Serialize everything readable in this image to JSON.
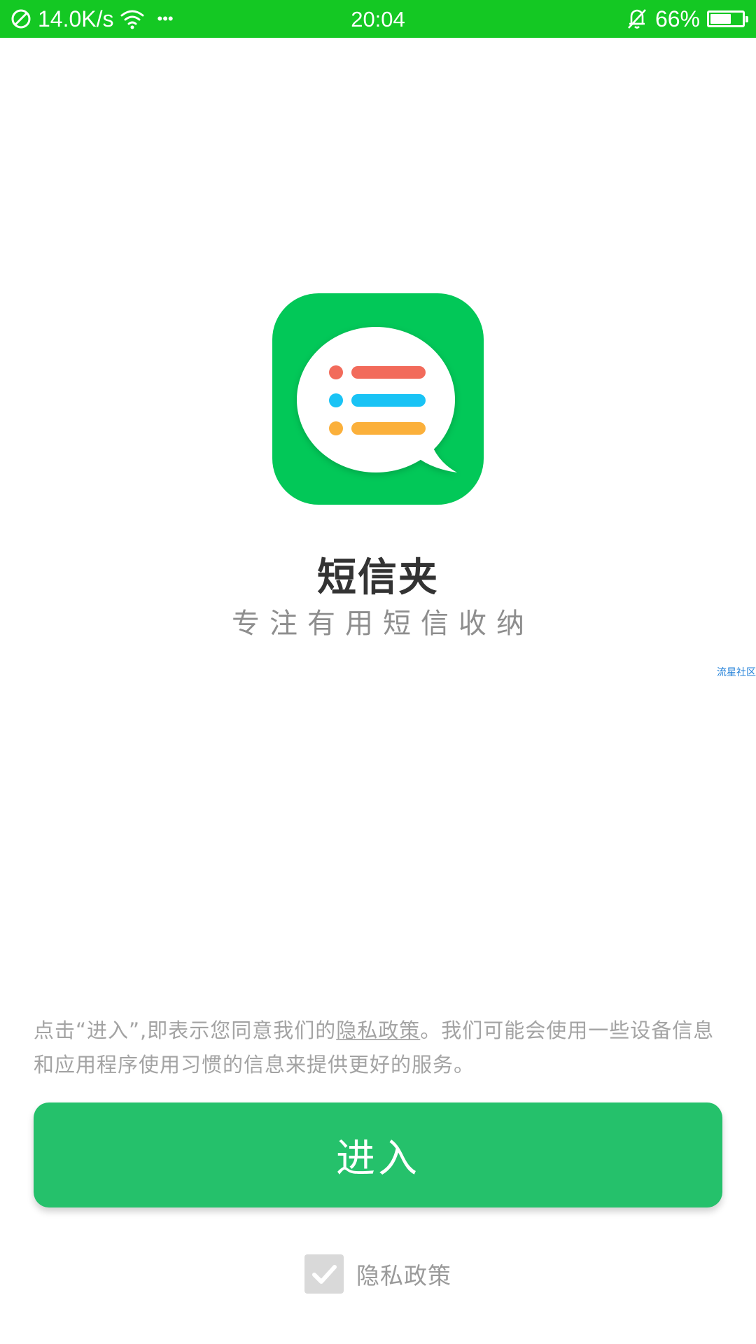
{
  "status_bar": {
    "network_speed": "14.0K/s",
    "more_dots": "•••",
    "time": "20:04",
    "battery_percent": "66%",
    "battery_level": 0.66,
    "icons": [
      "no-sim-icon",
      "wifi-icon",
      "bell-muted-icon",
      "battery-icon"
    ]
  },
  "app": {
    "name": "短信夹",
    "slogan": "专注有用短信收纳",
    "icon_colors": {
      "background": "#02c858",
      "bubble": "#ffffff",
      "row1": "#f26b5b",
      "row2": "#19c3f5",
      "row3": "#fbb03b"
    }
  },
  "watermark": "流星社区",
  "notice": {
    "prefix": "点击“进入”,即表示您同意我们的",
    "link": "隐私政策",
    "suffix": "。我们可能会使用一些设备信息和应用程序使用习惯的信息来提供更好的服务。"
  },
  "enter_button": {
    "label": "进入",
    "color": "#25c16b"
  },
  "privacy_checkbox": {
    "label": "隐私政策",
    "checked": true
  },
  "colors": {
    "status_bar": "#14c823",
    "title": "#333333",
    "subtle_text": "#a3a3a3"
  }
}
